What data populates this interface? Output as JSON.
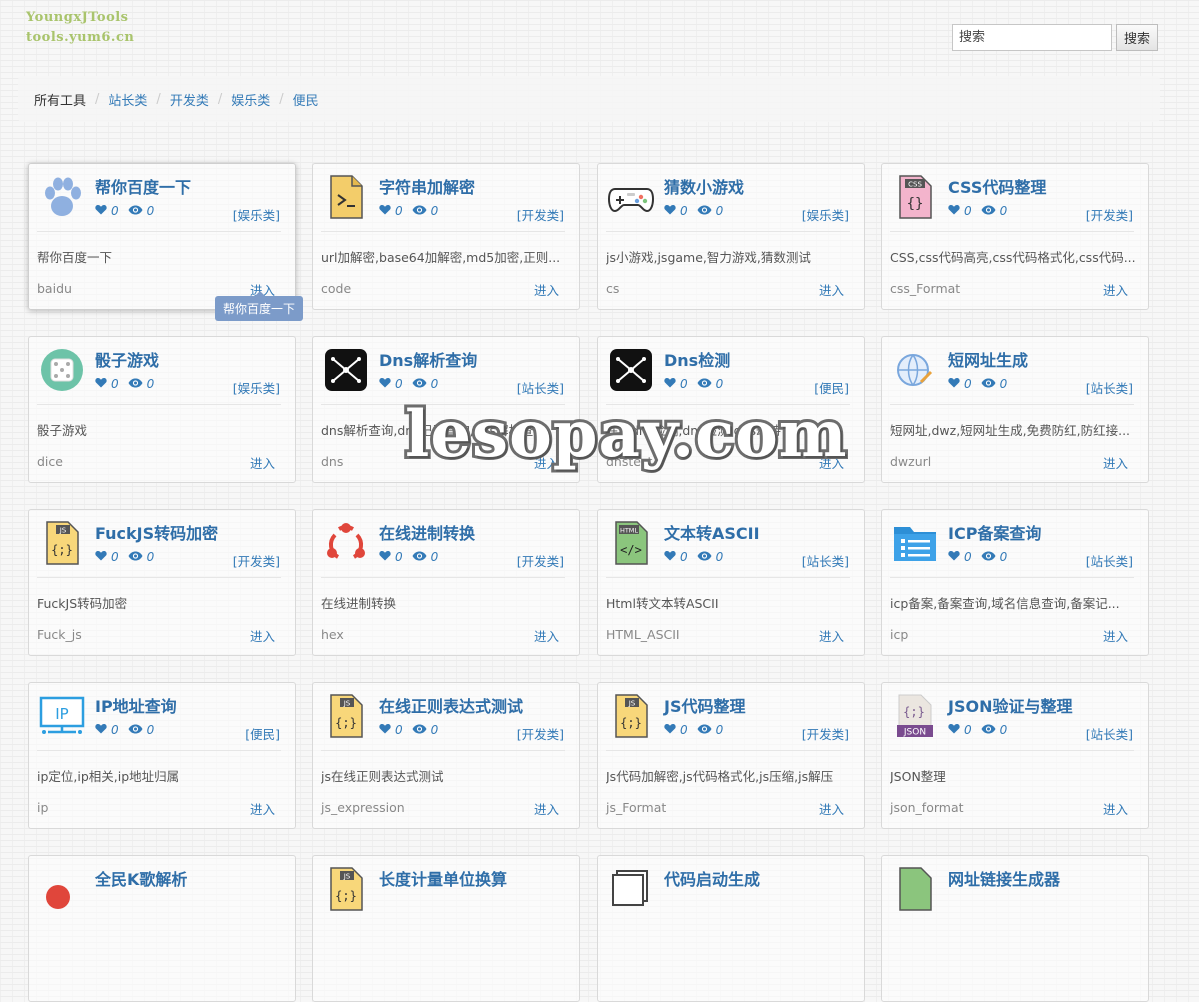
{
  "header": {
    "logo_line1": "YoungxJTools",
    "logo_line2": "tools.yum6.cn",
    "search_placeholder": "搜索",
    "search_button": "搜索"
  },
  "breadcrumb": [
    "所有工具",
    "站长类",
    "开发类",
    "娱乐类",
    "便民"
  ],
  "enter_label": "进入",
  "tooltip": "帮你百度一下",
  "watermark": "lesopay.com",
  "colors": {
    "link": "#337ab7",
    "title": "#2f6ea8",
    "tooltip_bg": "#7c9bc9",
    "logo": "#a9c46c"
  },
  "cards": [
    {
      "title": "帮你百度一下",
      "likes": "0",
      "views": "0",
      "category": "[娱乐类]",
      "desc": "帮你百度一下",
      "code": "baidu",
      "icon": "paw-icon"
    },
    {
      "title": "字符串加解密",
      "likes": "0",
      "views": "0",
      "category": "[开发类]",
      "desc": "url加解密,base64加解密,md5加密,正则...",
      "code": "code",
      "icon": "terminal-file-icon"
    },
    {
      "title": "猜数小游戏",
      "likes": "0",
      "views": "0",
      "category": "[娱乐类]",
      "desc": "js小游戏,jsgame,智力游戏,猜数测试",
      "code": "cs",
      "icon": "gamepad-icon"
    },
    {
      "title": "CSS代码整理",
      "likes": "0",
      "views": "0",
      "category": "[开发类]",
      "desc": "CSS,css代码高亮,css代码格式化,css代码...",
      "code": "css_Format",
      "icon": "css-file-icon"
    },
    {
      "title": "骰子游戏",
      "likes": "0",
      "views": "0",
      "category": "[娱乐类]",
      "desc": "骰子游戏",
      "code": "dice",
      "icon": "dice-icon"
    },
    {
      "title": "Dns解析查询",
      "likes": "0",
      "views": "0",
      "category": "[站长类]",
      "desc": "dns解析查询,dns记录查询,dns解析查询",
      "code": "dns",
      "icon": "dns-icon"
    },
    {
      "title": "Dns检测",
      "likes": "0",
      "views": "0",
      "category": "[便民]",
      "desc": "在线dns检测,dns检测,dns劫持",
      "code": "dnstest",
      "icon": "dns-icon"
    },
    {
      "title": "短网址生成",
      "likes": "0",
      "views": "0",
      "category": "[站长类]",
      "desc": "短网址,dwz,短网址生成,免费防红,防红接...",
      "code": "dwzurl",
      "icon": "globe-link-icon"
    },
    {
      "title": "FuckJS转码加密",
      "likes": "0",
      "views": "0",
      "category": "[开发类]",
      "desc": "FuckJS转码加密",
      "code": "Fuck_js",
      "icon": "js-file-icon"
    },
    {
      "title": "在线进制转换",
      "likes": "0",
      "views": "0",
      "category": "[开发类]",
      "desc": "在线进制转换",
      "code": "hex",
      "icon": "share-icon"
    },
    {
      "title": "文本转ASCII",
      "likes": "0",
      "views": "0",
      "category": "[站长类]",
      "desc": "Html转文本转ASCII",
      "code": "HTML_ASCII",
      "icon": "html-file-icon"
    },
    {
      "title": "ICP备案查询",
      "likes": "0",
      "views": "0",
      "category": "[站长类]",
      "desc": "icp备案,备案查询,域名信息查询,备案记...",
      "code": "icp",
      "icon": "folder-list-icon"
    },
    {
      "title": "IP地址查询",
      "likes": "0",
      "views": "0",
      "category": "[便民]",
      "desc": "ip定位,ip相关,ip地址归属",
      "code": "ip",
      "icon": "ip-monitor-icon"
    },
    {
      "title": "在线正则表达式测试",
      "likes": "0",
      "views": "0",
      "category": "[开发类]",
      "desc": "js在线正则表达式测试",
      "code": "js_expression",
      "icon": "js-file-icon"
    },
    {
      "title": "JS代码整理",
      "likes": "0",
      "views": "0",
      "category": "[开发类]",
      "desc": "Js代码加解密,js代码格式化,js压缩,js解压",
      "code": "js_Format",
      "icon": "js-file-icon"
    },
    {
      "title": "JSON验证与整理",
      "likes": "0",
      "views": "0",
      "category": "[站长类]",
      "desc": "JSON整理",
      "code": "json_format",
      "icon": "json-file-icon"
    },
    {
      "title": "全民K歌解析",
      "likes": "",
      "views": "",
      "category": "",
      "desc": "",
      "code": "",
      "icon": "music-icon"
    },
    {
      "title": "长度计量单位换算",
      "likes": "",
      "views": "",
      "category": "",
      "desc": "",
      "code": "",
      "icon": "js-file-icon"
    },
    {
      "title": "代码启动生成",
      "likes": "",
      "views": "",
      "category": "",
      "desc": "",
      "code": "",
      "icon": "stack-icon"
    },
    {
      "title": "网址链接生成器",
      "likes": "",
      "views": "",
      "category": "",
      "desc": "",
      "code": "",
      "icon": "link-icon"
    }
  ]
}
